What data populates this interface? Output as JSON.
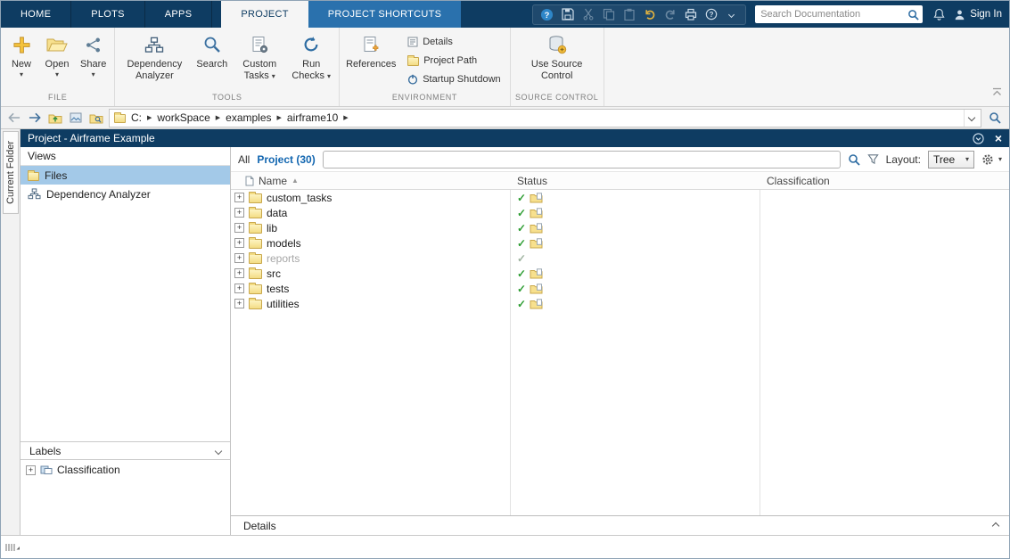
{
  "icons": {
    "check": "✓",
    "plus": "+",
    "sort_ascending": "▲",
    "breadcrumb_arrow": "▶",
    "dropdown_arrow": "▾",
    "close": "×"
  },
  "window": {
    "tabs": [
      "HOME",
      "PLOTS",
      "APPS",
      "PROJECT",
      "PROJECT SHORTCUTS"
    ],
    "doc_search_placeholder": "Search Documentation",
    "sign_in": "Sign In"
  },
  "ribbon": {
    "file": {
      "label": "FILE",
      "new": "New",
      "open": "Open",
      "share": "Share"
    },
    "tools": {
      "label": "TOOLS",
      "dependency_analyzer": "Dependency Analyzer",
      "search": "Search",
      "custom_tasks": "Custom Tasks",
      "run_checks": "Run Checks"
    },
    "environment": {
      "label": "ENVIRONMENT",
      "references": "References",
      "details": "Details",
      "project_path": "Project Path",
      "startup_shutdown": "Startup Shutdown"
    },
    "source_control": {
      "label": "SOURCE CONTROL",
      "use_source_control": "Use Source Control"
    }
  },
  "addressbar": {
    "segments": [
      "C:",
      "workSpace",
      "examples",
      "airframe10"
    ]
  },
  "dock": {
    "current_folder": "Current Folder"
  },
  "panel": {
    "title": "Project - Airframe Example",
    "views": {
      "header": "Views",
      "files": "Files",
      "dependency_analyzer": "Dependency Analyzer"
    },
    "labels": {
      "header": "Labels",
      "classification": "Classification"
    },
    "toolbar": {
      "all": "All",
      "project": "Project (30)",
      "layout_label": "Layout:",
      "layout_value": "Tree"
    },
    "table": {
      "columns": [
        "Name",
        "Status",
        "Classification"
      ],
      "rows": [
        {
          "name": "custom_tasks"
        },
        {
          "name": "data"
        },
        {
          "name": "lib"
        },
        {
          "name": "models"
        },
        {
          "name": "reports",
          "dimmed": true
        },
        {
          "name": "src"
        },
        {
          "name": "tests"
        },
        {
          "name": "utilities"
        }
      ]
    },
    "details": "Details"
  }
}
